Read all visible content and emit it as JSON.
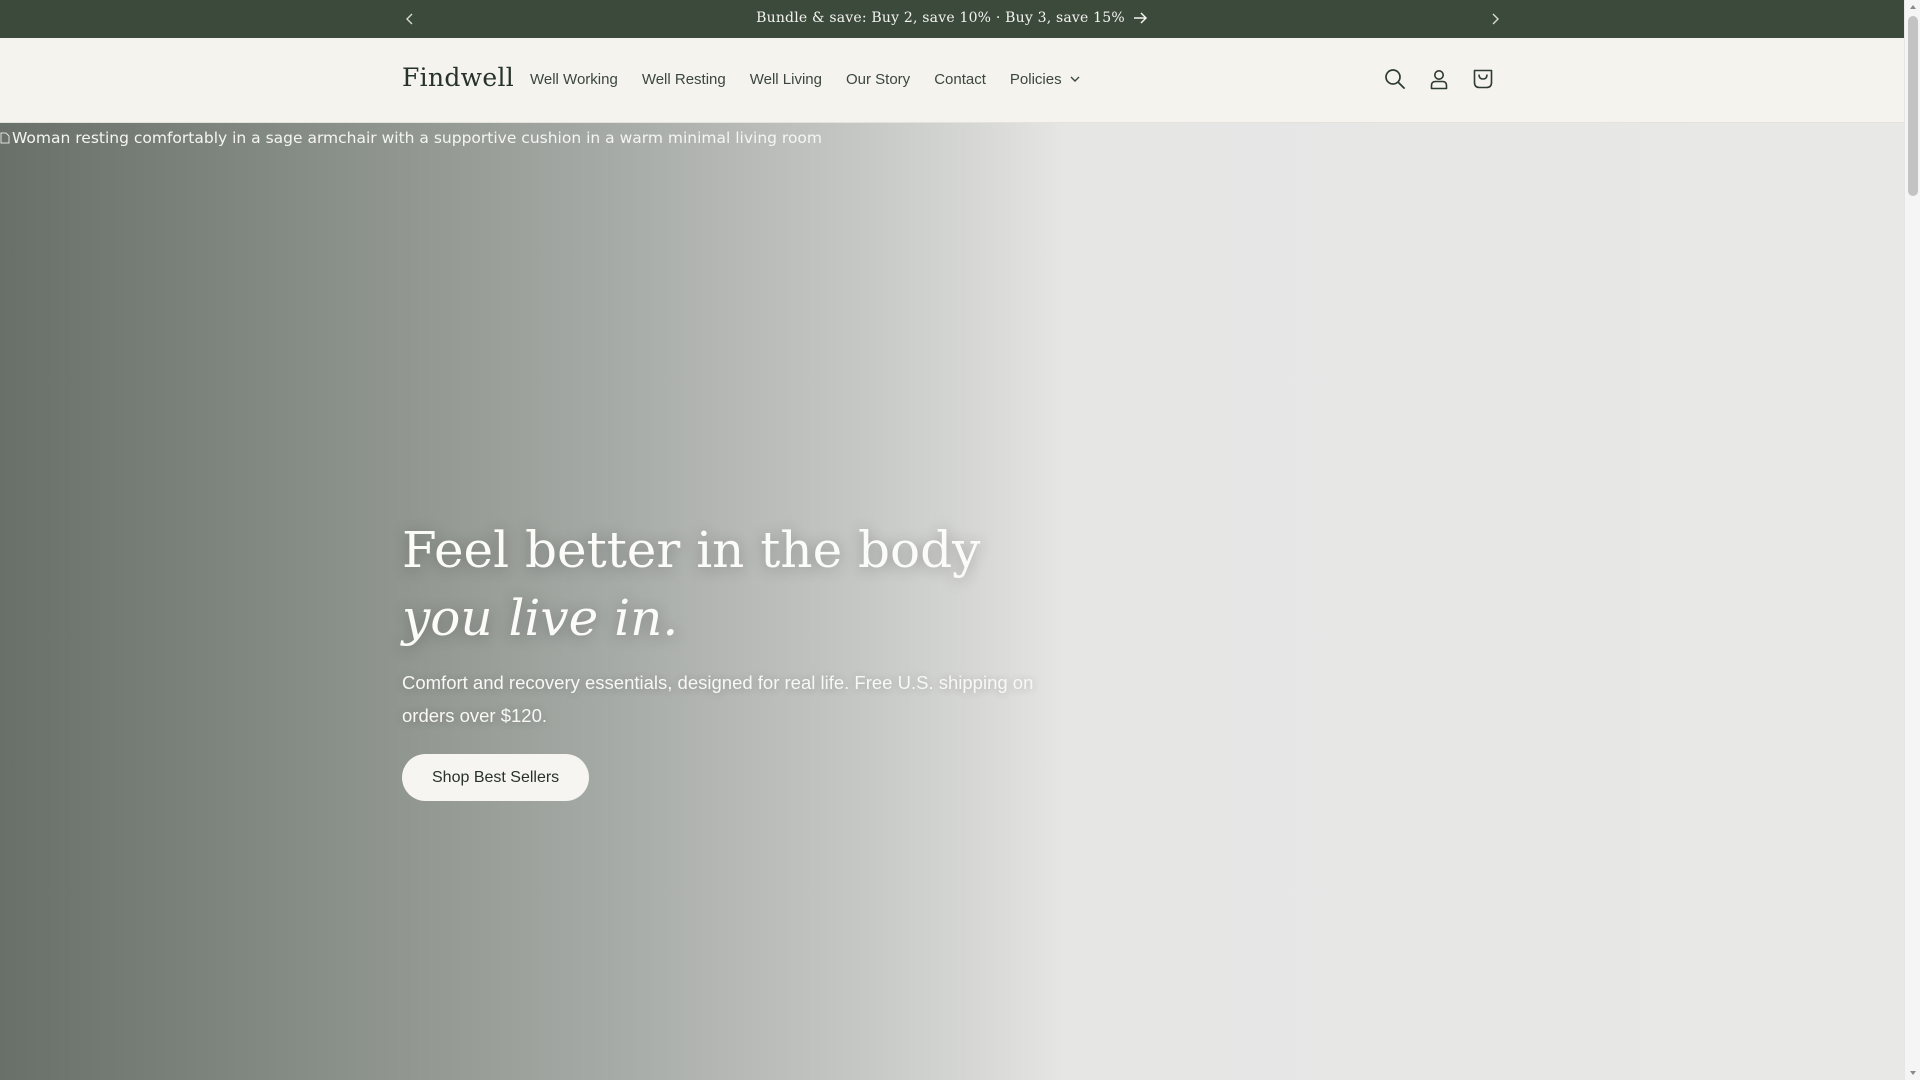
{
  "announcement": {
    "message": "Bundle & save: Buy 2, save 10% · Buy 3, save 15%",
    "prev_icon": "chevron-left-icon",
    "next_icon": "chevron-right-icon",
    "arrow_icon": "arrow-right-icon"
  },
  "header": {
    "logo": "Findwell",
    "nav": [
      {
        "label": "Well Working"
      },
      {
        "label": "Well Resting"
      },
      {
        "label": "Well Living"
      },
      {
        "label": "Our Story"
      },
      {
        "label": "Contact"
      },
      {
        "label": "Policies"
      }
    ],
    "icons": [
      "search-icon",
      "account-icon",
      "cart-icon"
    ]
  },
  "hero": {
    "image_alt": "Woman resting comfortably in a sage armchair with a supportive cushion in a warm minimal living room",
    "title_plain": "Feel better in the body ",
    "title_italic": "you live in.",
    "subtitle": "Comfort and recovery essentials, designed for real life. Free U.S. shipping on orders over $120.",
    "cta_label": "Shop Best Sellers"
  },
  "colors": {
    "announcement_bg": "#3c4a3c",
    "header_bg": "#f4f3ee",
    "hero_fade_start": "#687069",
    "hero_fade_end": "#e8e8e7",
    "button_bg": "#f6f5f1"
  }
}
